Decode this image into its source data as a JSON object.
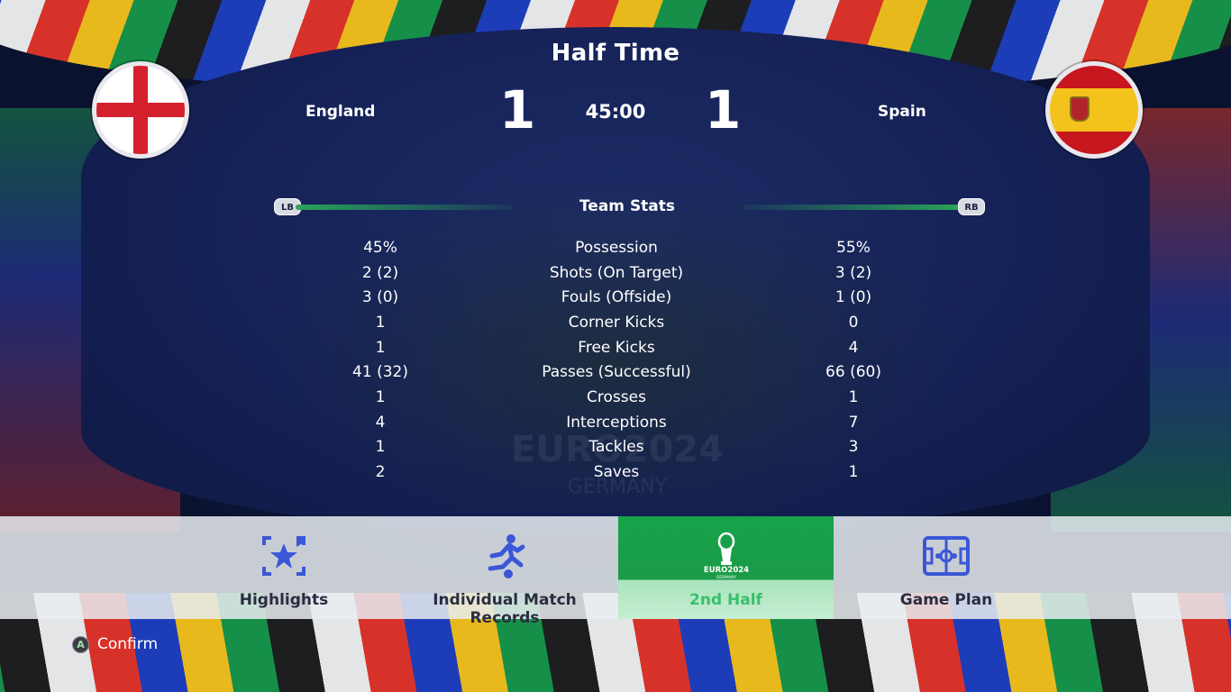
{
  "header": {
    "title": "Half Time",
    "clock": "45:00"
  },
  "home": {
    "name": "England",
    "score": "1",
    "flag": "england-flag"
  },
  "away": {
    "name": "Spain",
    "score": "1",
    "flag": "spain-flag"
  },
  "stats": {
    "title": "Team Stats",
    "left_button": "LB",
    "right_button": "RB",
    "rows": [
      {
        "label": "Possession",
        "home": "45%",
        "away": "55%"
      },
      {
        "label": "Shots (On Target)",
        "home": "2 (2)",
        "away": "3 (2)"
      },
      {
        "label": "Fouls (Offside)",
        "home": "3 (0)",
        "away": "1 (0)"
      },
      {
        "label": "Corner Kicks",
        "home": "1",
        "away": "0"
      },
      {
        "label": "Free Kicks",
        "home": "1",
        "away": "4"
      },
      {
        "label": "Passes (Successful)",
        "home": "41 (32)",
        "away": "66 (60)"
      },
      {
        "label": "Crosses",
        "home": "1",
        "away": "1"
      },
      {
        "label": "Interceptions",
        "home": "4",
        "away": "7"
      },
      {
        "label": "Tackles",
        "home": "1",
        "away": "3"
      },
      {
        "label": "Saves",
        "home": "2",
        "away": "1"
      }
    ]
  },
  "menu": {
    "items": [
      {
        "label": "Highlights",
        "icon": "highlights-star-icon"
      },
      {
        "label": "Individual Match Records",
        "icon": "player-kick-icon"
      },
      {
        "label": "2nd Half",
        "icon": "euro-trophy-icon",
        "selected": true,
        "icon_text": "EURO2024",
        "icon_subtext": "GERMANY"
      },
      {
        "label": "Game Plan",
        "icon": "game-plan-pitch-icon"
      }
    ]
  },
  "footer": {
    "button": "A",
    "label": "Confirm"
  },
  "background": {
    "watermark": "EURO2024",
    "watermark_sub": "GERMANY"
  },
  "colors": {
    "accent_green": "#17a34a",
    "menu_blue": "#3b57d6",
    "england_red": "#d4202c",
    "spain_red": "#c8161e",
    "spain_yellow": "#f3c21b"
  }
}
